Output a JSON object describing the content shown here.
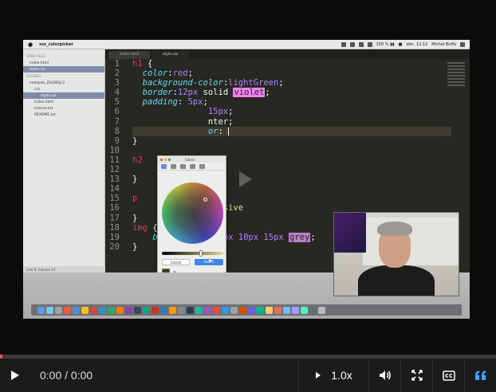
{
  "menubar": {
    "app_name": "sss_colorpicker",
    "status_right": "100 % ▮▮",
    "flag": "■",
    "clock": "Ven. 12:12",
    "user": "Michel Buffa"
  },
  "window": {
    "title": "style.css — codepen_ZLGWQJ 2"
  },
  "sidebar": {
    "open_files_label": "OPEN FILES",
    "open_files": [
      "index.html",
      "style.css"
    ],
    "folders_label": "FOLDERS",
    "folder": "codepen_ZLGWQJ 2",
    "subfolder": "css",
    "items": [
      "style.css",
      "index.html",
      "license.txt",
      "README.txt"
    ],
    "selected_index": 0
  },
  "tabs": [
    "index.html",
    "style.css"
  ],
  "active_tab": 1,
  "gutter": [
    "1",
    "2",
    "3",
    "4",
    "5",
    "6",
    "7",
    "8",
    "9",
    "10",
    "11",
    "12",
    "13",
    "14",
    "15",
    "16",
    "17",
    "18",
    "19",
    "20"
  ],
  "statusbar": {
    "text": "Line 8, Column 23"
  },
  "picker": {
    "title": "Colors",
    "cancel_label": "Cancel",
    "select_label": "Select"
  },
  "controls": {
    "time": "0:00 / 0:00",
    "speed": "1.0x",
    "progress": 0.005
  },
  "icons": {
    "play": "play-icon",
    "speed_arrow": "speed-menu-icon",
    "volume": "volume-icon",
    "fullscreen": "fullscreen-icon",
    "captions": "captions-icon",
    "quote": "quote-icon"
  },
  "colors": {
    "accent": "#3ea6ff",
    "progress_red": "#e6554f"
  }
}
